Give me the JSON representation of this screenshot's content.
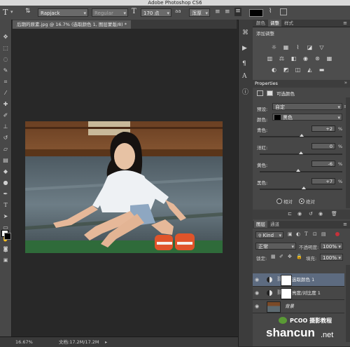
{
  "app": {
    "title": "Adobe Photoshop CS6"
  },
  "options_bar": {
    "font_family": "Rapjack",
    "font_style": "Regular",
    "font_size": "170 点",
    "antialias": "浑厚"
  },
  "document_tab": {
    "label": "后期的原素.jpg @ 16.7% (选取颜色 1, 图层蒙版/8) *"
  },
  "status": {
    "zoom": "16.67%",
    "doc_info": "文档:17.2M/17.2M"
  },
  "adjustments_panel": {
    "tabs": [
      "颜色",
      "调整",
      "样式"
    ],
    "active_tab": "调整",
    "title": "添加调整"
  },
  "properties_panel": {
    "header": "Properties",
    "type_label": "可选颜色",
    "preset_label": "预设:",
    "preset_value": "自定",
    "colors_label": "颜色:",
    "colors_value": "黑色",
    "sliders": [
      {
        "label": "青色:",
        "value": "+2",
        "fraction": 0.51
      },
      {
        "label": "洋红:",
        "value": "0",
        "fraction": 0.5
      },
      {
        "label": "黄色:",
        "value": "-6",
        "fraction": 0.47
      },
      {
        "label": "黑色:",
        "value": "+7",
        "fraction": 0.53
      }
    ],
    "method_relative": "相对",
    "method_absolute": "绝对",
    "method_selected": "absolute"
  },
  "layers_panel": {
    "tabs": [
      "图层",
      "通道"
    ],
    "filter_kind": "Kind",
    "blend_mode": "正常",
    "opacity_label": "不透明度:",
    "opacity_value": "100%",
    "lock_label": "锁定:",
    "fill_label": "填充:",
    "fill_value": "100%",
    "layers": [
      {
        "name": "选取颜色 1",
        "selected": true
      },
      {
        "name": "亮度/对比度 1",
        "selected": false
      },
      {
        "name": "背景",
        "selected": false
      }
    ]
  },
  "watermark": {
    "line1": "PCOO 摄影教程",
    "line2": "shancun",
    "line3": ".net"
  },
  "colors": {
    "accent_selected": "#5d6b80",
    "panel_bg": "#474747",
    "canvas_bg": "#282828"
  }
}
